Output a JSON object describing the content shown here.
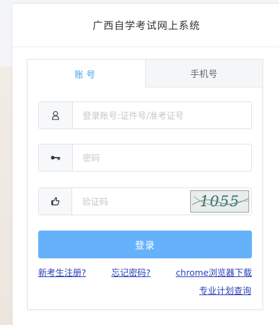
{
  "header": {
    "title": "广西自学考试网上系统"
  },
  "tabs": [
    {
      "label": "账号",
      "active": true
    },
    {
      "label": "手机号",
      "active": false
    }
  ],
  "form": {
    "account": {
      "placeholder": "登录账号:证件号/准考证号",
      "value": "",
      "icon": "user-icon"
    },
    "password": {
      "placeholder": "密码",
      "value": "",
      "icon": "key-icon"
    },
    "captcha": {
      "placeholder": "验证码",
      "value": "",
      "icon": "hand-pointer-icon",
      "image_text": "1055"
    },
    "login_label": "登录"
  },
  "links": {
    "register": "新考生注册?",
    "forgot": "忘记密码?",
    "browser_download": "chrome浏览器下载",
    "plan_query": "专业计划查询"
  },
  "colors": {
    "accent": "#4aa1f0",
    "button": "#66b2fa",
    "link": "#2a3fb8"
  }
}
